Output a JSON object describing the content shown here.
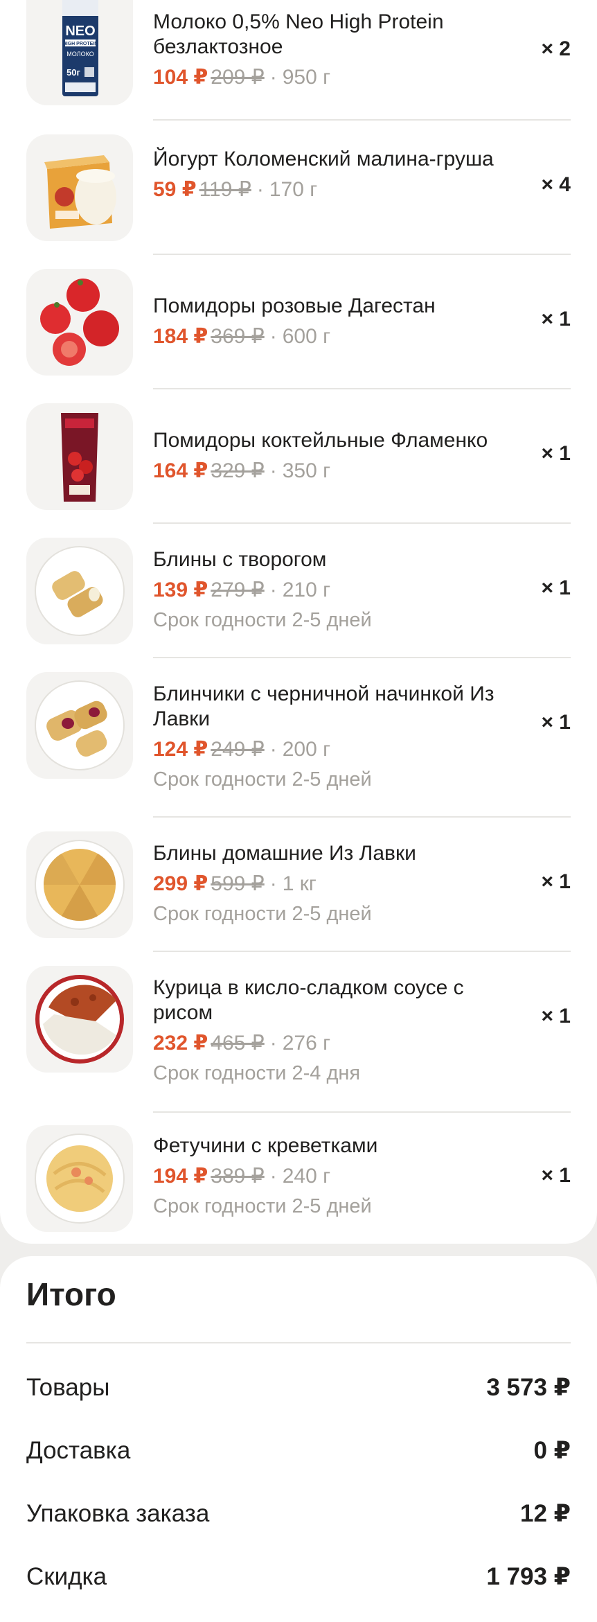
{
  "items": [
    {
      "name": "Молоко 0,5% Neo High Protein безлактозное",
      "price": "104 ₽",
      "old_price": "209 ₽",
      "weight": "950 г",
      "qty": "× 2",
      "expiry": ""
    },
    {
      "name": "Йогурт Коломенский малина-груша",
      "price": "59 ₽",
      "old_price": "119 ₽",
      "weight": "170 г",
      "qty": "× 4",
      "expiry": ""
    },
    {
      "name": "Помидоры розовые Дагестан",
      "price": "184 ₽",
      "old_price": "369 ₽",
      "weight": "600 г",
      "qty": "× 1",
      "expiry": ""
    },
    {
      "name": "Помидоры коктейльные Фламенко",
      "price": "164 ₽",
      "old_price": "329 ₽",
      "weight": "350 г",
      "qty": "× 1",
      "expiry": ""
    },
    {
      "name": "Блины с творогом",
      "price": "139 ₽",
      "old_price": "279 ₽",
      "weight": "210 г",
      "qty": "× 1",
      "expiry": "Срок годности 2-5 дней"
    },
    {
      "name": "Блинчики с черничной начинкой Из Лавки",
      "price": "124 ₽",
      "old_price": "249 ₽",
      "weight": "200 г",
      "qty": "× 1",
      "expiry": "Срок годности 2-5 дней"
    },
    {
      "name": "Блины домашние Из Лавки",
      "price": "299 ₽",
      "old_price": "599 ₽",
      "weight": "1 кг",
      "qty": "× 1",
      "expiry": "Срок годности 2-5 дней"
    },
    {
      "name": "Курица в кисло-сладком соусе с рисом",
      "price": "232 ₽",
      "old_price": "465 ₽",
      "weight": "276 г",
      "qty": "× 1",
      "expiry": "Срок годности 2-4 дня"
    },
    {
      "name": "Фетучини с креветками",
      "price": "194 ₽",
      "old_price": "389 ₽",
      "weight": "240 г",
      "qty": "× 1",
      "expiry": "Срок годности 2-5 дней"
    }
  ],
  "product_images": [
    "milk-carton-image",
    "yogurt-cup-image",
    "pink-tomatoes-image",
    "cocktail-tomatoes-pack-image",
    "pancakes-cottage-cheese-image",
    "blueberry-pancakes-image",
    "homemade-pancakes-image",
    "sweet-sour-chicken-rice-image",
    "fettuccine-shrimp-image"
  ],
  "milk_pack_text": {
    "brand": "NEO",
    "line": "HIGH PROTEIN",
    "product": "МОЛОКО",
    "protein": "50г"
  },
  "summary": {
    "title": "Итого",
    "rows": [
      {
        "label": "Товары",
        "value": "3 573 ₽"
      },
      {
        "label": "Доставка",
        "value": "0 ₽"
      },
      {
        "label": "Упаковка заказа",
        "value": "12 ₽"
      },
      {
        "label": "Скидка",
        "value": "1 793 ₽"
      }
    ]
  },
  "colors": {
    "price": "#e0552c",
    "muted": "#a4a19c",
    "text": "#21201f",
    "background": "#efeeec"
  }
}
